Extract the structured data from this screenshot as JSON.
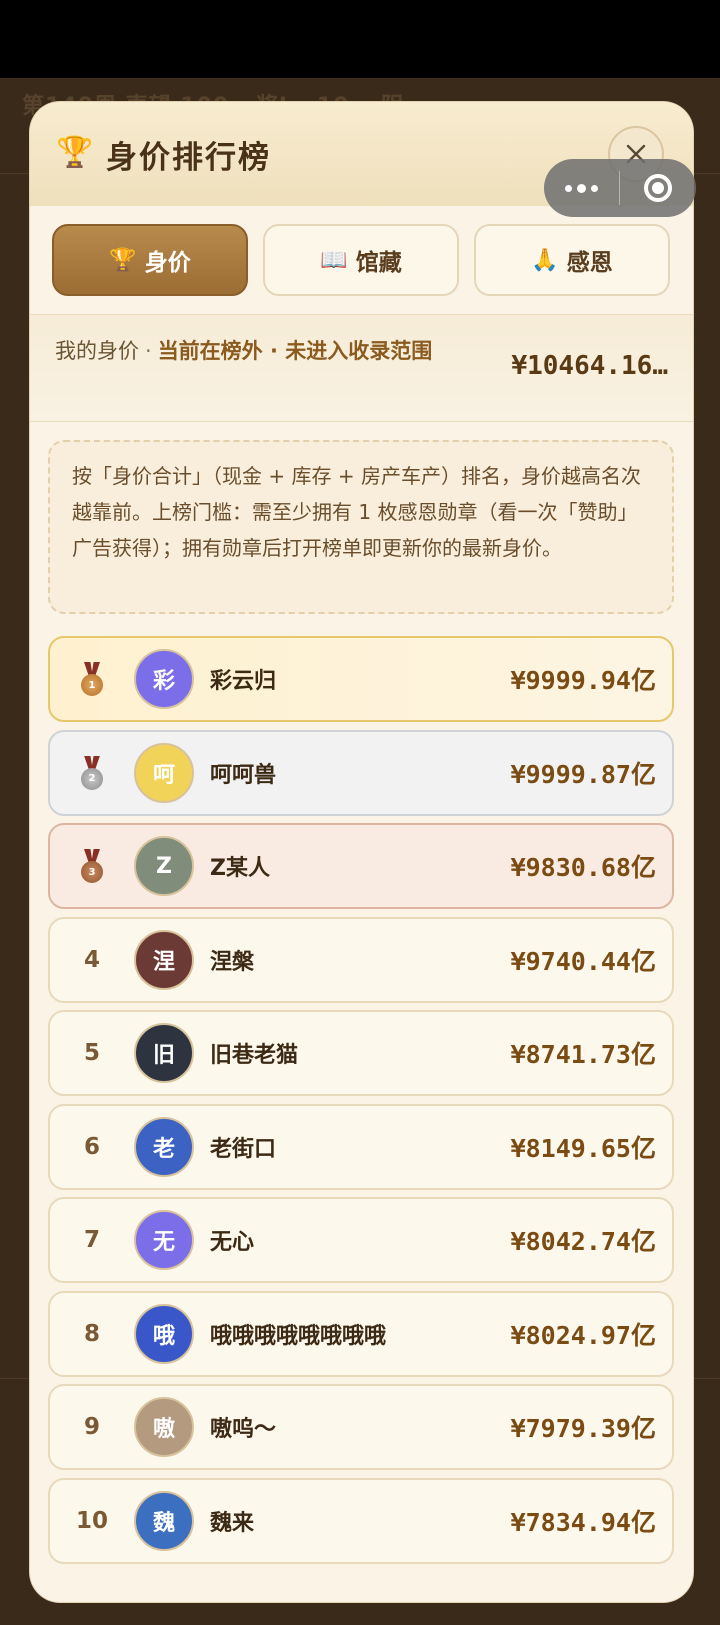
{
  "background": {
    "text": "第140周 声望 100 · 奖Lv.10 ☁阴"
  },
  "modal": {
    "title": "身价排行榜",
    "title_icon": "trophy-icon",
    "close_icon": "close-icon"
  },
  "capsule": {
    "more_icon": "more-dots-icon",
    "exit_icon": "exit-circle-icon"
  },
  "tabs": [
    {
      "label": "身价",
      "icon": "🏆",
      "active": true
    },
    {
      "label": "馆藏",
      "icon": "📖",
      "active": false
    },
    {
      "label": "感恩",
      "icon": "🙏",
      "active": false
    }
  ],
  "my_rank": {
    "label": "我的身价",
    "dot": "·",
    "status": "当前在榜外 · 未进入收录范围",
    "value": "¥10464.16…"
  },
  "description": "按「身价合计」（现金 + 库存 + 房产车产）排名，身价越高名次越靠前。上榜门槛：需至少拥有 1 枚感恩勋章（看一次「赞助」广告获得）；拥有勋章后打开榜单即更新你的最新身价。",
  "leaderboard": [
    {
      "rank": "1",
      "medal": "gold",
      "name": "彩云归",
      "value": "¥9999.94亿",
      "avatar_color": "#7b6ee8",
      "avatar_text": "彩"
    },
    {
      "rank": "2",
      "medal": "silver",
      "name": "呵呵兽",
      "value": "¥9999.87亿",
      "avatar_color": "#f1d35a",
      "avatar_text": "呵"
    },
    {
      "rank": "3",
      "medal": "bronze",
      "name": "Z某人",
      "value": "¥9830.68亿",
      "avatar_color": "#7f8d7a",
      "avatar_text": "Z"
    },
    {
      "rank": "4",
      "medal": "",
      "name": "涅槃",
      "value": "¥9740.44亿",
      "avatar_color": "#6b3a34",
      "avatar_text": "涅"
    },
    {
      "rank": "5",
      "medal": "",
      "name": "旧巷老猫",
      "value": "¥8741.73亿",
      "avatar_color": "#2e3340",
      "avatar_text": "旧"
    },
    {
      "rank": "6",
      "medal": "",
      "name": "老街口",
      "value": "¥8149.65亿",
      "avatar_color": "#3c62c4",
      "avatar_text": "老"
    },
    {
      "rank": "7",
      "medal": "",
      "name": "无心",
      "value": "¥8042.74亿",
      "avatar_color": "#7b6ee8",
      "avatar_text": "无"
    },
    {
      "rank": "8",
      "medal": "",
      "name": "哦哦哦哦哦哦哦哦",
      "value": "¥8024.97亿",
      "avatar_color": "#3957c9",
      "avatar_text": "哦"
    },
    {
      "rank": "9",
      "medal": "",
      "name": "嗷呜～",
      "value": "¥7979.39亿",
      "avatar_color": "#b49a7e",
      "avatar_text": "嗷"
    },
    {
      "rank": "10",
      "medal": "",
      "name": "魏来",
      "value": "¥7834.94亿",
      "avatar_color": "#3d6fc0",
      "avatar_text": "魏"
    }
  ]
}
